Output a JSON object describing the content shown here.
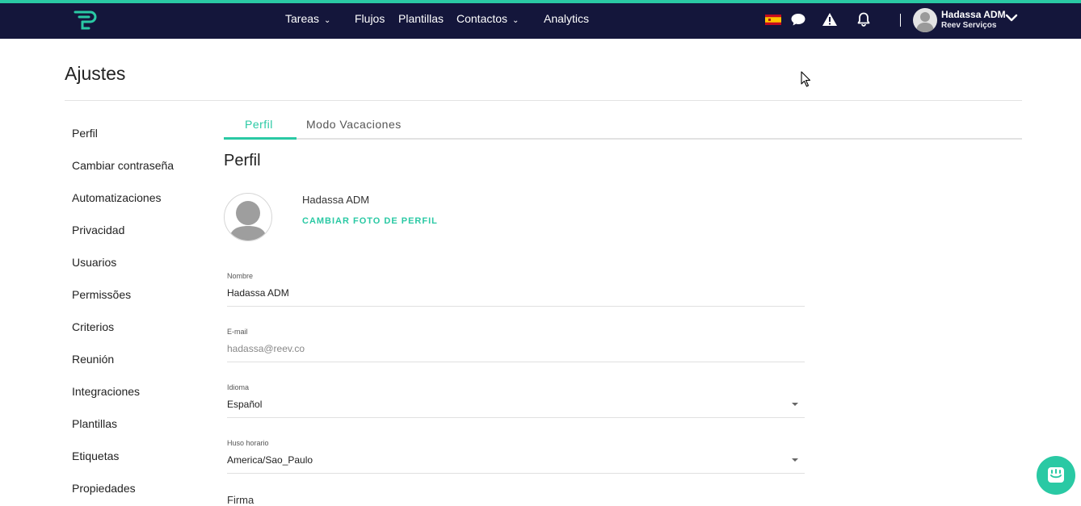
{
  "nav": {
    "items": [
      {
        "label": "Tareas",
        "has_dropdown": true
      },
      {
        "label": "Flujos",
        "has_dropdown": false
      },
      {
        "label": "Plantillas",
        "has_dropdown": false
      },
      {
        "label": "Contactos",
        "has_dropdown": true
      },
      {
        "label": "Analytics",
        "has_dropdown": false
      }
    ],
    "icons": [
      "logo-icon",
      "spain-flag-icon",
      "chat-icon",
      "warning-icon",
      "bell-icon",
      "chevron-down-icon"
    ]
  },
  "user": {
    "name": "Hadassa ADM",
    "company": "Reev Serviços"
  },
  "page": {
    "title": "Ajustes"
  },
  "sidebar": {
    "items": [
      {
        "label": "Perfil"
      },
      {
        "label": "Cambiar contraseña"
      },
      {
        "label": "Automatizaciones"
      },
      {
        "label": "Privacidad"
      },
      {
        "label": "Usuarios"
      },
      {
        "label": "Permissões"
      },
      {
        "label": "Criterios"
      },
      {
        "label": "Reunión"
      },
      {
        "label": "Integraciones"
      },
      {
        "label": "Plantillas"
      },
      {
        "label": "Etiquetas"
      },
      {
        "label": "Propiedades"
      }
    ]
  },
  "tabs": [
    {
      "label": "Perfil",
      "active": true
    },
    {
      "label": "Modo Vacaciones",
      "active": false
    }
  ],
  "profile": {
    "section_title": "Perfil",
    "display_name": "Hadassa ADM",
    "change_photo_label": "CAMBIAR FOTO DE PERFIL"
  },
  "form": {
    "name": {
      "label": "Nombre",
      "value": "Hadassa ADM"
    },
    "email": {
      "label": "E-mail",
      "value": "hadassa@reev.co"
    },
    "language": {
      "label": "Idioma",
      "value": "Español"
    },
    "timezone": {
      "label": "Huso horario",
      "value": "America/Sao_Paulo"
    },
    "signature": {
      "label": "Firma"
    }
  },
  "colors": {
    "accent": "#2ac9a4",
    "topbar": "#14163b"
  }
}
